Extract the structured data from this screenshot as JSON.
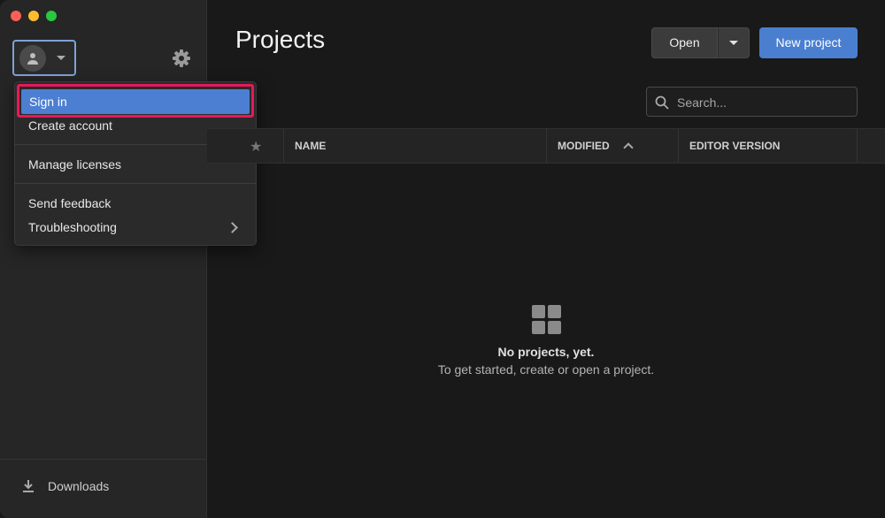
{
  "sidebar": {
    "downloads_label": "Downloads"
  },
  "menu": {
    "items": [
      {
        "label": "Sign in"
      },
      {
        "label": "Create account"
      },
      {
        "label": "Manage licenses"
      },
      {
        "label": "Send feedback"
      },
      {
        "label": "Troubleshooting"
      }
    ]
  },
  "main": {
    "title": "Projects",
    "open_label": "Open",
    "new_project_label": "New project",
    "search_placeholder": "Search...",
    "columns": [
      "NAME",
      "MODIFIED",
      "EDITOR VERSION"
    ],
    "empty_title": "No projects, yet.",
    "empty_subtitle": "To get started, create or open a project."
  },
  "colors": {
    "accent": "#4a7fd0",
    "highlight": "#e8175d"
  },
  "icons": [
    "avatar-icon",
    "gear-icon",
    "download-icon",
    "search-icon",
    "star-icon",
    "grid-icon"
  ]
}
